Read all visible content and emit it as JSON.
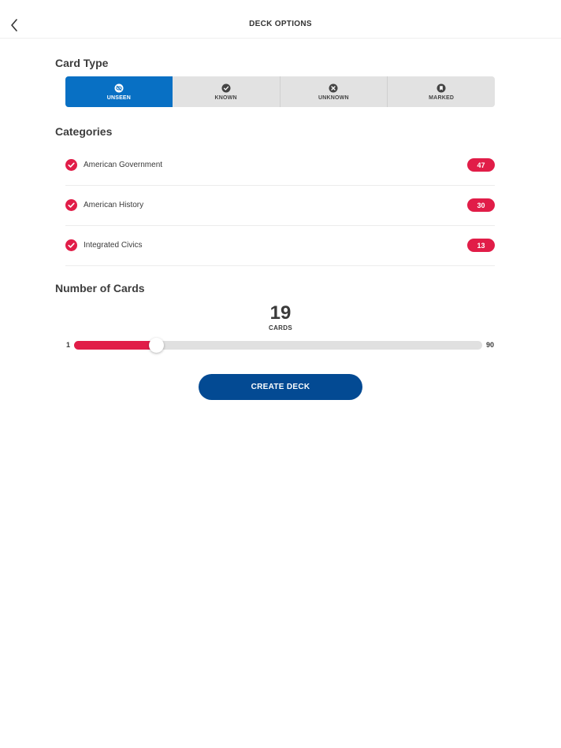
{
  "header": {
    "title": "DECK OPTIONS",
    "back_icon": "chevron-left-icon"
  },
  "card_type": {
    "title": "Card Type",
    "selected": "UNSEEN",
    "accent_color": "#0870c4",
    "options": [
      {
        "label": "UNSEEN",
        "icon": "eye-slash-icon",
        "active": true
      },
      {
        "label": "KNOWN",
        "icon": "check-circle-icon",
        "active": false
      },
      {
        "label": "UNKNOWN",
        "icon": "x-circle-icon",
        "active": false
      },
      {
        "label": "MARKED",
        "icon": "bookmark-circle-icon",
        "active": false
      }
    ]
  },
  "categories": {
    "title": "Categories",
    "badge_color": "#e11d48",
    "items": [
      {
        "label": "American Government",
        "count": "47",
        "checked": true
      },
      {
        "label": "American History",
        "count": "30",
        "checked": true
      },
      {
        "label": "Integrated Civics",
        "count": "13",
        "checked": true
      }
    ]
  },
  "number_of_cards": {
    "title": "Number of Cards",
    "value": "19",
    "unit": "CARDS",
    "min": "1",
    "max": "90",
    "fill_color": "#e11d48"
  },
  "create_button": {
    "label": "CREATE DECK",
    "color": "#034a93"
  }
}
